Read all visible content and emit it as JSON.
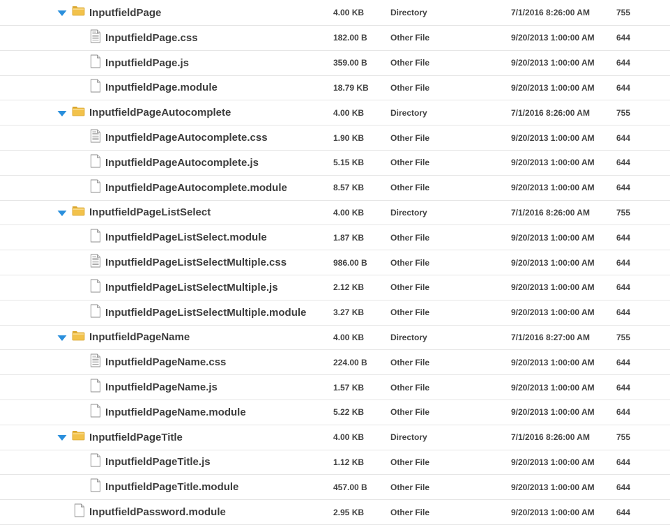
{
  "rows": [
    {
      "type": "dir",
      "depth": 0,
      "name": "InputfieldPage",
      "size": "4.00 KB",
      "kind": "Directory",
      "date": "7/1/2016 8:26:00 AM",
      "perm": "755"
    },
    {
      "type": "file",
      "icon": "text",
      "depth": 1,
      "name": "InputfieldPage.css",
      "size": "182.00 B",
      "kind": "Other File",
      "date": "9/20/2013 1:00:00 AM",
      "perm": "644"
    },
    {
      "type": "file",
      "icon": "blank",
      "depth": 1,
      "name": "InputfieldPage.js",
      "size": "359.00 B",
      "kind": "Other File",
      "date": "9/20/2013 1:00:00 AM",
      "perm": "644"
    },
    {
      "type": "file",
      "icon": "blank",
      "depth": 1,
      "name": "InputfieldPage.module",
      "size": "18.79 KB",
      "kind": "Other File",
      "date": "9/20/2013 1:00:00 AM",
      "perm": "644"
    },
    {
      "type": "dir",
      "depth": 0,
      "name": "InputfieldPageAutocomplete",
      "size": "4.00 KB",
      "kind": "Directory",
      "date": "7/1/2016 8:26:00 AM",
      "perm": "755"
    },
    {
      "type": "file",
      "icon": "text",
      "depth": 1,
      "name": "InputfieldPageAutocomplete.css",
      "size": "1.90 KB",
      "kind": "Other File",
      "date": "9/20/2013 1:00:00 AM",
      "perm": "644"
    },
    {
      "type": "file",
      "icon": "blank",
      "depth": 1,
      "name": "InputfieldPageAutocomplete.js",
      "size": "5.15 KB",
      "kind": "Other File",
      "date": "9/20/2013 1:00:00 AM",
      "perm": "644"
    },
    {
      "type": "file",
      "icon": "blank",
      "depth": 1,
      "name": "InputfieldPageAutocomplete.module",
      "size": "8.57 KB",
      "kind": "Other File",
      "date": "9/20/2013 1:00:00 AM",
      "perm": "644"
    },
    {
      "type": "dir",
      "depth": 0,
      "name": "InputfieldPageListSelect",
      "size": "4.00 KB",
      "kind": "Directory",
      "date": "7/1/2016 8:26:00 AM",
      "perm": "755"
    },
    {
      "type": "file",
      "icon": "blank",
      "depth": 1,
      "name": "InputfieldPageListSelect.module",
      "size": "1.87 KB",
      "kind": "Other File",
      "date": "9/20/2013 1:00:00 AM",
      "perm": "644"
    },
    {
      "type": "file",
      "icon": "text",
      "depth": 1,
      "name": "InputfieldPageListSelectMultiple.css",
      "size": "986.00 B",
      "kind": "Other File",
      "date": "9/20/2013 1:00:00 AM",
      "perm": "644"
    },
    {
      "type": "file",
      "icon": "blank",
      "depth": 1,
      "name": "InputfieldPageListSelectMultiple.js",
      "size": "2.12 KB",
      "kind": "Other File",
      "date": "9/20/2013 1:00:00 AM",
      "perm": "644"
    },
    {
      "type": "file",
      "icon": "blank",
      "depth": 1,
      "name": "InputfieldPageListSelectMultiple.module",
      "size": "3.27 KB",
      "kind": "Other File",
      "date": "9/20/2013 1:00:00 AM",
      "perm": "644"
    },
    {
      "type": "dir",
      "depth": 0,
      "name": "InputfieldPageName",
      "size": "4.00 KB",
      "kind": "Directory",
      "date": "7/1/2016 8:27:00 AM",
      "perm": "755"
    },
    {
      "type": "file",
      "icon": "text",
      "depth": 1,
      "name": "InputfieldPageName.css",
      "size": "224.00 B",
      "kind": "Other File",
      "date": "9/20/2013 1:00:00 AM",
      "perm": "644"
    },
    {
      "type": "file",
      "icon": "blank",
      "depth": 1,
      "name": "InputfieldPageName.js",
      "size": "1.57 KB",
      "kind": "Other File",
      "date": "9/20/2013 1:00:00 AM",
      "perm": "644"
    },
    {
      "type": "file",
      "icon": "blank",
      "depth": 1,
      "name": "InputfieldPageName.module",
      "size": "5.22 KB",
      "kind": "Other File",
      "date": "9/20/2013 1:00:00 AM",
      "perm": "644"
    },
    {
      "type": "dir",
      "depth": 0,
      "name": "InputfieldPageTitle",
      "size": "4.00 KB",
      "kind": "Directory",
      "date": "7/1/2016 8:26:00 AM",
      "perm": "755"
    },
    {
      "type": "file",
      "icon": "blank",
      "depth": 1,
      "name": "InputfieldPageTitle.js",
      "size": "1.12 KB",
      "kind": "Other File",
      "date": "9/20/2013 1:00:00 AM",
      "perm": "644"
    },
    {
      "type": "file",
      "icon": "blank",
      "depth": 1,
      "name": "InputfieldPageTitle.module",
      "size": "457.00 B",
      "kind": "Other File",
      "date": "9/20/2013 1:00:00 AM",
      "perm": "644"
    },
    {
      "type": "file",
      "icon": "blank",
      "depth": 0,
      "name": "InputfieldPassword.module",
      "size": "2.95 KB",
      "kind": "Other File",
      "date": "9/20/2013 1:00:00 AM",
      "perm": "644"
    }
  ],
  "colors": {
    "twisty": "#2a8fdc",
    "folder": "#f2c24b",
    "folder_dark": "#d9a52c",
    "border": "#e6e6e6",
    "text": "#3d3d3d"
  },
  "icons": {
    "expanded": "triangle-down-icon",
    "directory": "folder-icon",
    "text_file": "text-file-icon",
    "blank_file": "blank-file-icon"
  }
}
